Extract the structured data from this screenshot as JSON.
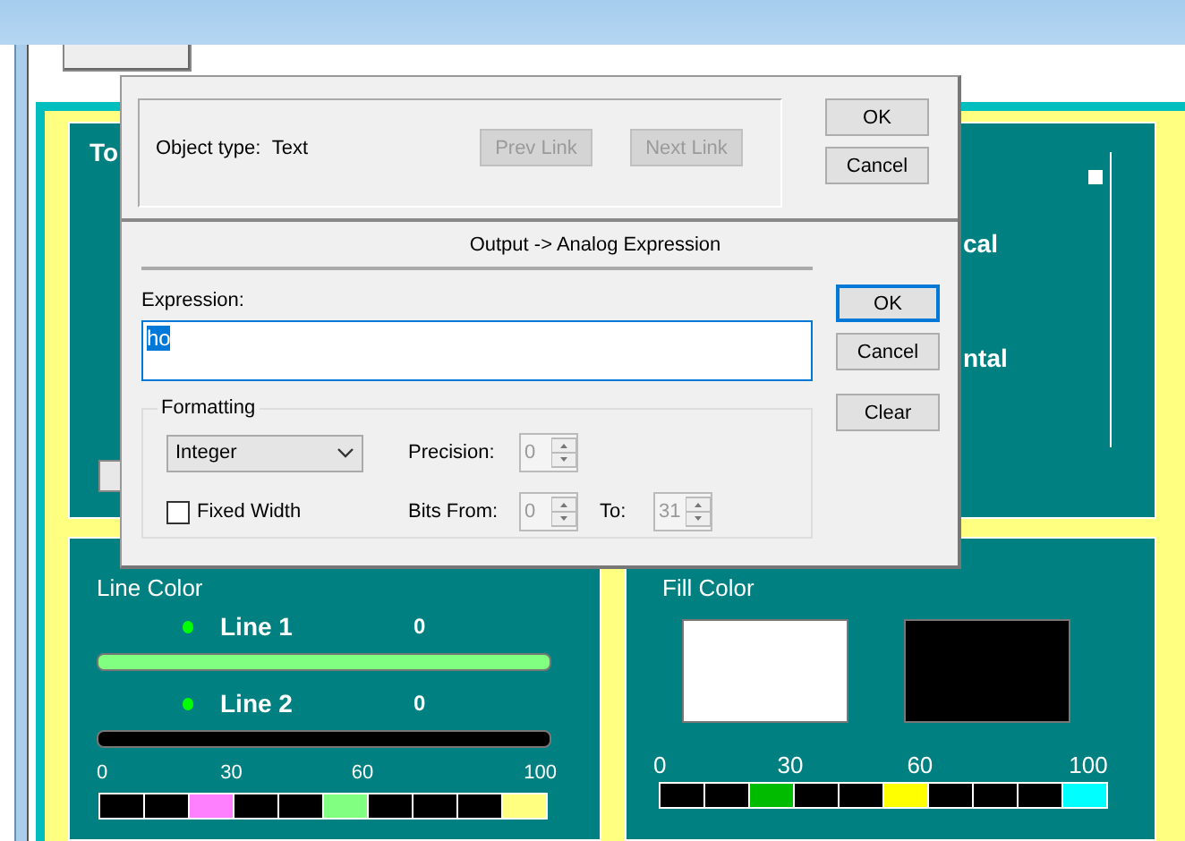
{
  "background": {
    "top_left_panel": {
      "title": "To"
    },
    "top_right_panel": {
      "labels": [
        "cal",
        "ntal"
      ]
    },
    "line_color": {
      "title": "Line Color",
      "lines": [
        {
          "label": "Line 1",
          "value": "0",
          "dot": {
            "color": "#00ff00"
          },
          "bar": {
            "color": "#80ff80"
          }
        },
        {
          "label": "Line 2",
          "value": "0",
          "dot": {
            "color": "#00ff00"
          },
          "bar": {
            "color": "#000000"
          }
        }
      ],
      "scale": [
        "0",
        "30",
        "60",
        "100"
      ],
      "swatches": [
        {
          "color": "#000000"
        },
        {
          "color": "#000000"
        },
        {
          "color": "#ff80ff"
        },
        {
          "color": "#000000"
        },
        {
          "color": "#000000"
        },
        {
          "color": "#80ff80"
        },
        {
          "color": "#000000"
        },
        {
          "color": "#000000"
        },
        {
          "color": "#000000"
        },
        {
          "color": "#ffff80"
        }
      ]
    },
    "fill_color": {
      "title": "Fill Color",
      "fills": [
        {
          "color": "#ffffff"
        },
        {
          "color": "#000000"
        }
      ],
      "scale": [
        "0",
        "30",
        "60",
        "100"
      ],
      "swatches": [
        {
          "color": "#000000"
        },
        {
          "color": "#000000"
        },
        {
          "color": "#00bb00"
        },
        {
          "color": "#000000"
        },
        {
          "color": "#000000"
        },
        {
          "color": "#ffff00"
        },
        {
          "color": "#000000"
        },
        {
          "color": "#000000"
        },
        {
          "color": "#000000"
        },
        {
          "color": "#00ffff"
        }
      ]
    }
  },
  "dialog": {
    "object_type_label": "Object type:",
    "object_type": "Text",
    "link_buttons": [
      {
        "label": "Prev Link",
        "disabled": true
      },
      {
        "label": "Next Link",
        "disabled": true
      }
    ],
    "buttons": [
      {
        "label": "OK",
        "default": false
      },
      {
        "label": "Cancel",
        "default": false
      }
    ],
    "section_title": "Output -> Analog Expression",
    "expression_label": "Expression:",
    "expression": "ho",
    "expression_selected": true,
    "side_buttons": [
      {
        "label": "OK",
        "default": true
      },
      {
        "label": "Cancel",
        "default": false
      },
      {
        "label": "Clear",
        "default": false
      }
    ],
    "formatting": {
      "title": "Formatting",
      "format": "Integer",
      "fixed_width": {
        "label": "Fixed Width",
        "checked": false
      },
      "spinners": [
        {
          "label": "Precision:",
          "value": "0",
          "disabled": true
        },
        {
          "label": "Bits From:",
          "value": "0",
          "disabled": true
        },
        {
          "label": "To:",
          "value": "31",
          "disabled": true
        }
      ]
    }
  }
}
